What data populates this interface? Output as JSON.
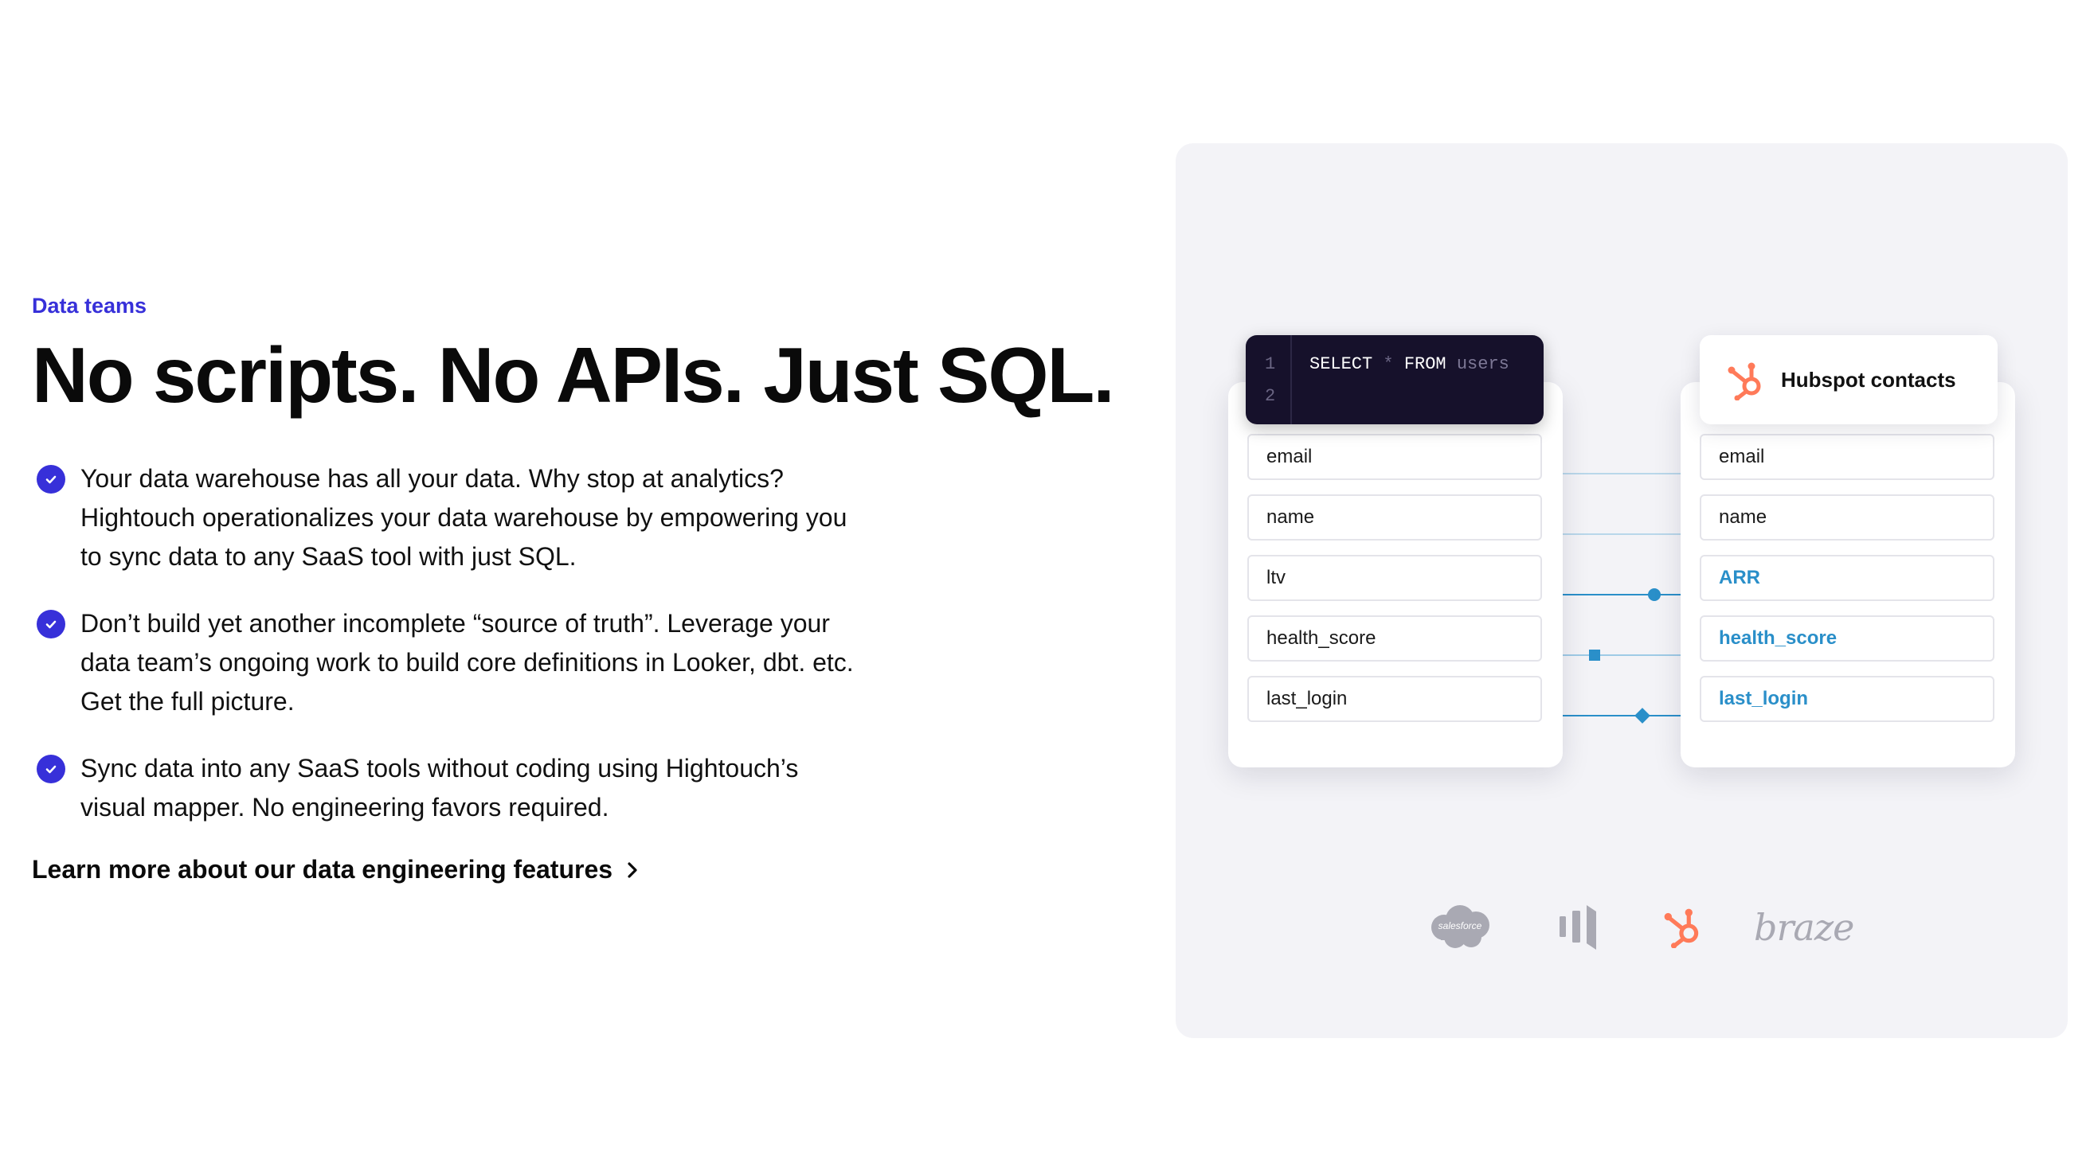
{
  "hero": {
    "eyebrow": "Data teams",
    "headline": "No scripts. No APIs. Just SQL.",
    "features": [
      "Your data warehouse has all your data. Why stop at analytics? Hightouch operationalizes your data warehouse by empowering you to sync data to any SaaS tool with just SQL.",
      "Don’t build yet another incomplete “source of truth”. Leverage your data team’s ongoing work to build core definitions in Looker, dbt. etc. Get the full picture.",
      "Sync data into any SaaS tools without coding using Hightouch’s visual mapper. No engineering favors required."
    ],
    "learn_more": "Learn more about our data engineering features"
  },
  "diagram": {
    "sql": {
      "line_numbers": [
        "1",
        "2"
      ],
      "keyword_select": "SELECT",
      "operator": "*",
      "keyword_from": "FROM",
      "table": "users"
    },
    "source_fields": [
      "email",
      "name",
      "ltv",
      "health_score",
      "last_login"
    ],
    "destination": {
      "title": "Hubspot contacts",
      "fields": [
        "email",
        "name",
        "ARR",
        "health_score",
        "last_login"
      ]
    },
    "logos": {
      "salesforce": "salesforce",
      "braze": "braze"
    }
  },
  "colors": {
    "accent": "#3730d9",
    "mapped_field": "#2a8fc9",
    "hubspot": "#ff7a59",
    "logo_gray": "#a9a9b3"
  }
}
